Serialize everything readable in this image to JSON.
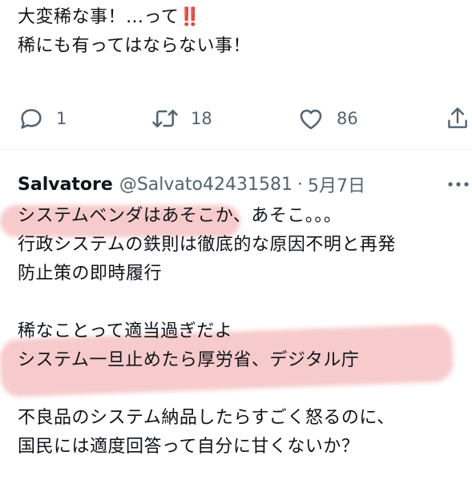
{
  "previous_tweet": {
    "lines": [
      "大変稀な事！…って",
      "稀にも有ってはならない事！"
    ],
    "emphasis": "‼️"
  },
  "actions": {
    "reply": {
      "icon": "reply-icon",
      "count": "1"
    },
    "retweet": {
      "icon": "retweet-icon",
      "count": "18"
    },
    "like": {
      "icon": "heart-icon",
      "count": "86"
    },
    "share": {
      "icon": "share-icon"
    }
  },
  "reply": {
    "display_name": "Salvatore",
    "handle": "@Salvato42431581",
    "separator": "·",
    "date": "5月7日",
    "more_icon": "more-dots-icon",
    "lines": [
      "システムベンダはあそこか、あそこ。。。",
      "行政システムの鉄則は徹底的な原因不明と再発",
      "防止策の即時履行",
      "",
      "稀なことって適当過ぎだよ",
      "システム一旦止めたら厚労省、デジタル庁",
      "",
      "不良品のシステム納品したらすごく怒るのに、",
      "国民には適度回答って自分に甘くないか？"
    ]
  },
  "colors": {
    "text": "#0f1419",
    "muted": "#536471",
    "highlight": "#ee8c8c",
    "emphasis": "#e0182d",
    "divider": "#eff3f4"
  }
}
